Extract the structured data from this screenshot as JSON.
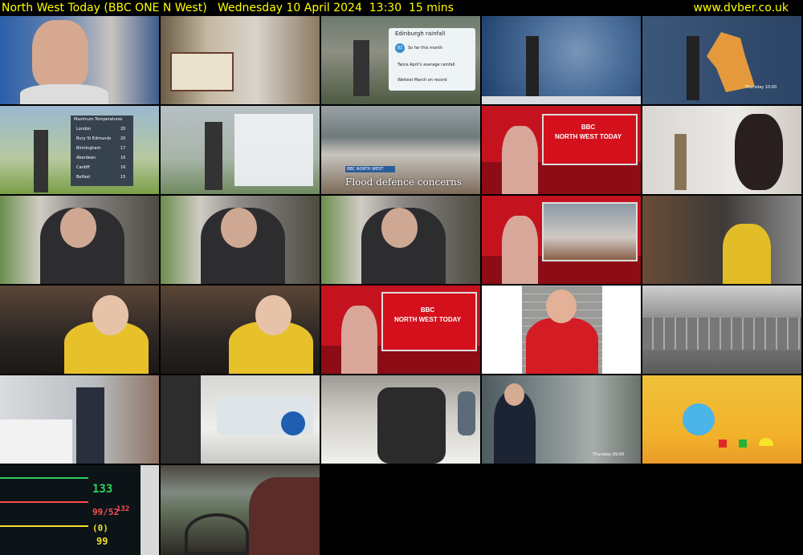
{
  "header": {
    "title": "North West Today (BBC ONE N West)   Wednesday 10 April 2024  13:30  15 mins",
    "site": "www.dvber.co.uk"
  },
  "thumbnails": {
    "t9_caption": "Flood defence concerns",
    "t9_bug": "BBC NORTH WEST",
    "t10_logo": "BBC",
    "t10_title": "NORTH WEST TODAY",
    "t18_logo": "BBC",
    "t18_title": "NORTH WEST TODAY",
    "t4_panel_title": "Edinburgh rainfall",
    "t4_line1": "So far this month",
    "t4_line2": "Twice April's average rainfall",
    "t4_line3": "Wettest March on record",
    "t4_value": "82",
    "t6_panel_title": "Maximum Temperatures",
    "t6_rows": [
      "London",
      "Bury St Edmunds",
      "Birmingham",
      "Aberdeen",
      "Cardiff",
      "Belfast"
    ],
    "t6_values": [
      "20",
      "20",
      "17",
      "16",
      "16",
      "15"
    ],
    "t5_day": "Thursday 10:00",
    "t24_day": "Thursday 09:00",
    "monitor_values": [
      "133",
      "99/52",
      "(0)",
      "99",
      "132"
    ]
  },
  "colors": {
    "header_text": "#ffff00",
    "bbc_red": "#d4101c"
  }
}
